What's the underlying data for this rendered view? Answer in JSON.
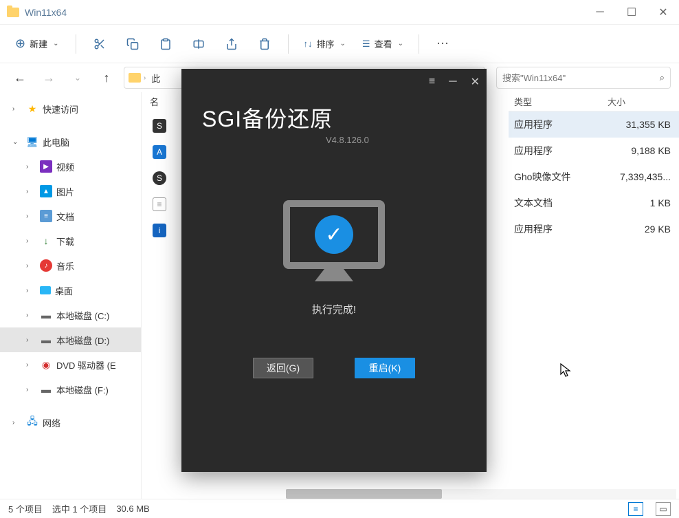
{
  "window": {
    "title": "Win11x64"
  },
  "toolbar": {
    "new_label": "新建",
    "sort_label": "排序",
    "view_label": "查看"
  },
  "address": {
    "crumb1": "此"
  },
  "search": {
    "placeholder": "搜索\"Win11x64\""
  },
  "sidebar": {
    "quick_access": "快速访问",
    "this_pc": "此电脑",
    "videos": "视频",
    "pictures": "图片",
    "documents": "文档",
    "downloads": "下载",
    "music": "音乐",
    "desktop": "桌面",
    "disk_c": "本地磁盘 (C:)",
    "disk_d": "本地磁盘 (D:)",
    "dvd": "DVD 驱动器 (E",
    "disk_f": "本地磁盘 (F:)",
    "network": "网络"
  },
  "columns": {
    "name_hdr": "名",
    "type_hdr": "类型",
    "size_hdr": "大小"
  },
  "files": [
    {
      "type": "应用程序",
      "size": "31,355 KB"
    },
    {
      "type": "应用程序",
      "size": "9,188 KB"
    },
    {
      "type": "Gho映像文件",
      "size": "7,339,435..."
    },
    {
      "type": "文本文档",
      "size": "1 KB"
    },
    {
      "type": "应用程序",
      "size": "29 KB"
    }
  ],
  "status": {
    "count": "5 个项目",
    "selection": "选中 1 个项目",
    "size": "30.6 MB"
  },
  "modal": {
    "app_name": "SGI备份还原",
    "version": "V4.8.126.0",
    "message": "执行完成!",
    "back_btn": "返回(G)",
    "restart_btn": "重启(K)"
  }
}
